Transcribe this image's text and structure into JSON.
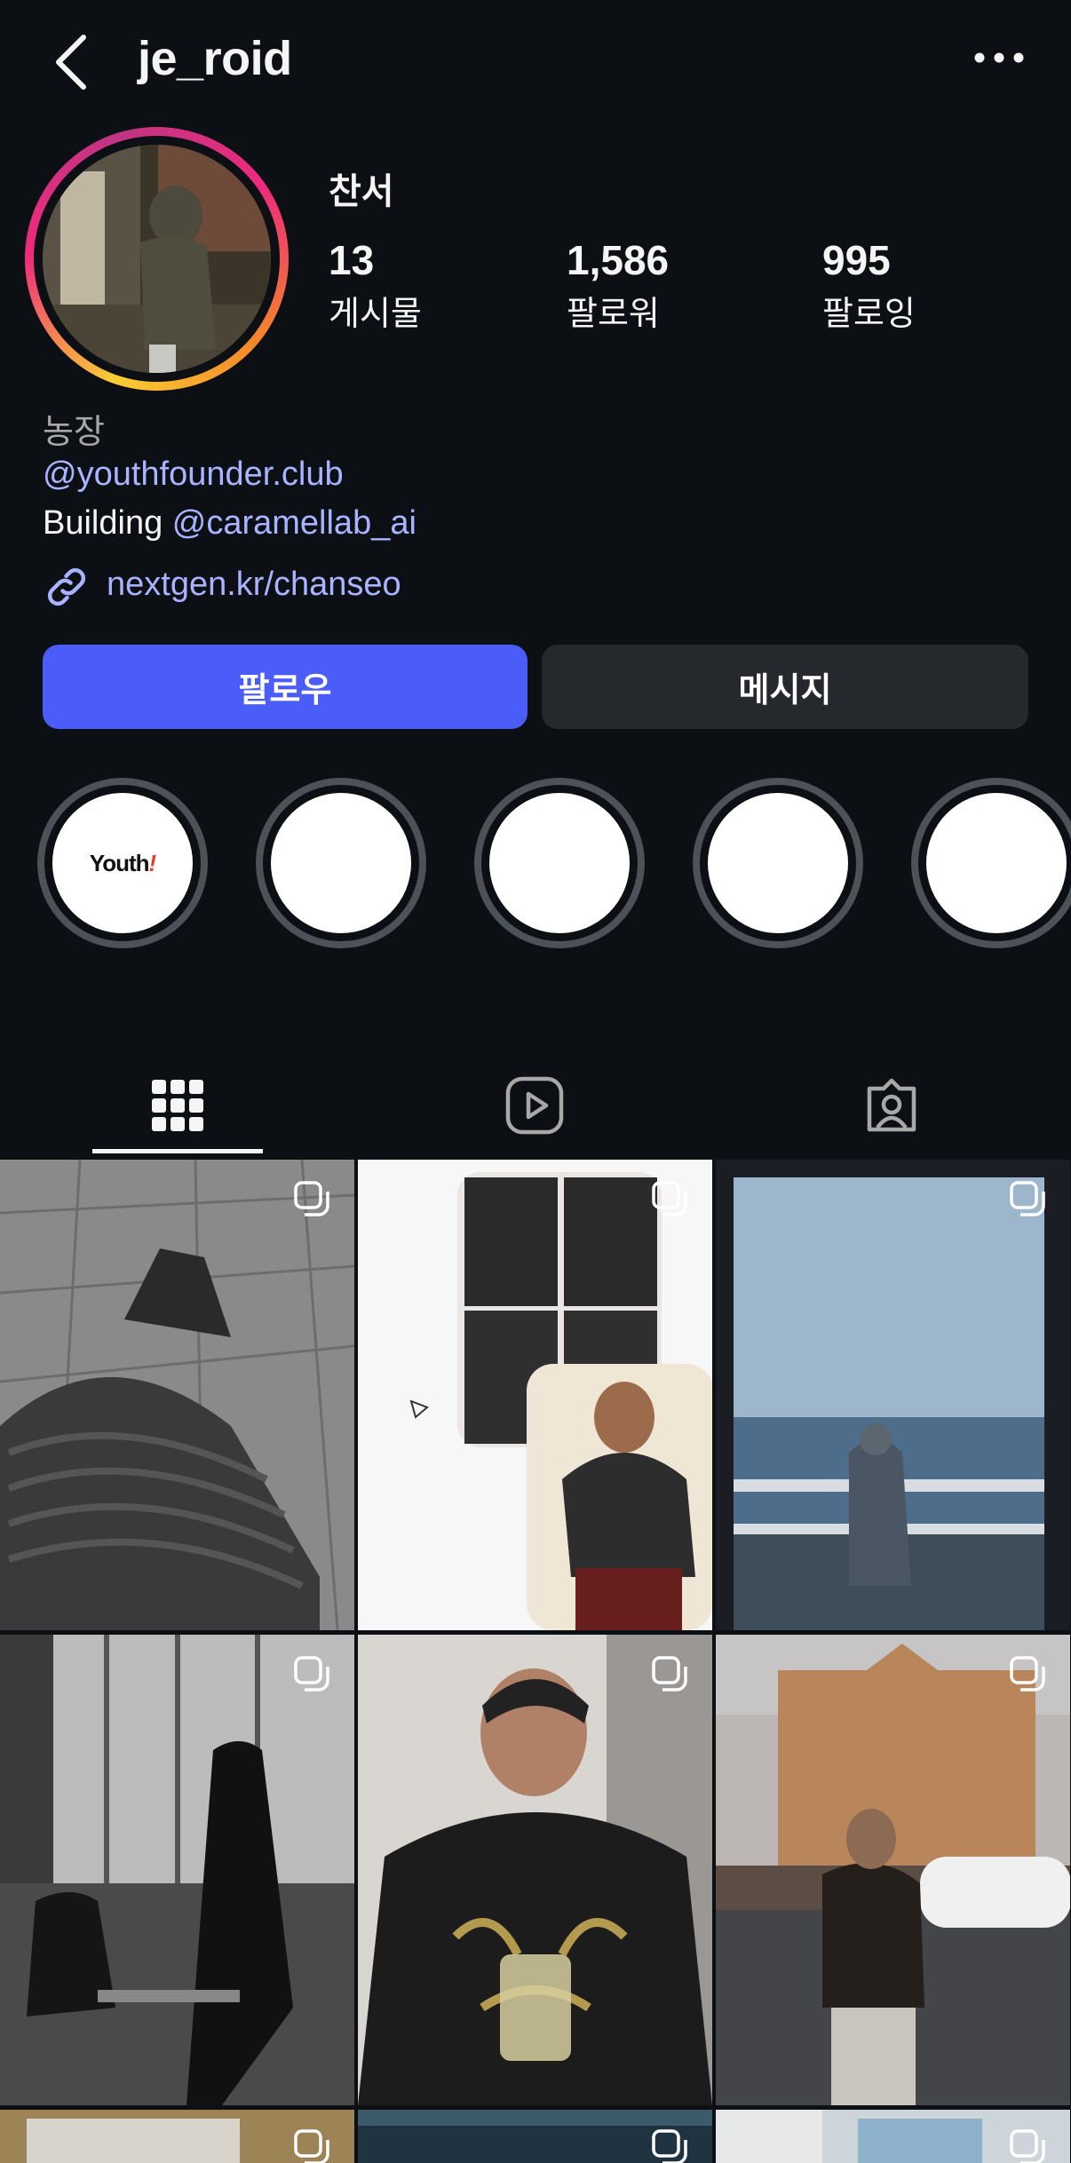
{
  "header": {
    "username": "je_roid"
  },
  "profile": {
    "full_name": "찬서",
    "stats": [
      {
        "value": "13",
        "label": "게시물"
      },
      {
        "value": "1,586",
        "label": "팔로워"
      },
      {
        "value": "995",
        "label": "팔로잉"
      }
    ],
    "category": "농장",
    "bio_mention": "@youthfounder.club",
    "bio_line2_prefix": "Building ",
    "bio_line2_mention": "@caramellab_ai",
    "link": "nextgen.kr/chanseo"
  },
  "buttons": {
    "follow": "팔로우",
    "message": "메시지"
  },
  "highlights": [
    {
      "logo_text": "Youth",
      "logo_mark": "!"
    },
    {
      "logo_text": ""
    },
    {
      "logo_text": ""
    },
    {
      "logo_text": ""
    },
    {
      "logo_text": ""
    }
  ],
  "tabs": [
    {
      "name": "grid-icon",
      "active": true
    },
    {
      "name": "reels-icon",
      "active": false
    },
    {
      "name": "tagged-icon",
      "active": false
    }
  ],
  "colors": {
    "background": "#0c1014",
    "follow_button": "#4a5df9",
    "message_button": "#25292e",
    "link_text": "#a8b4ff"
  }
}
